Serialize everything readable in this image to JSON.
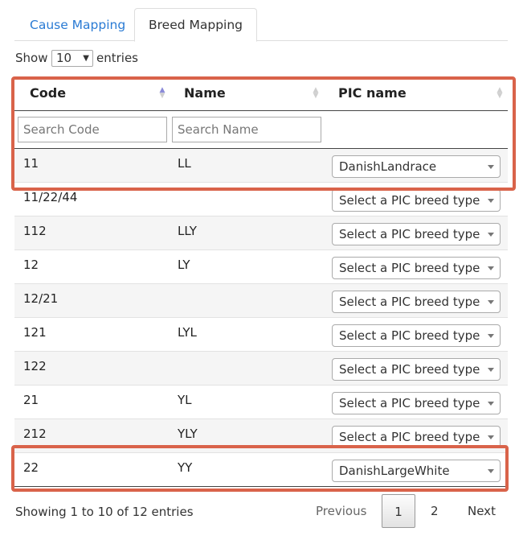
{
  "tabs": [
    {
      "label": "Cause Mapping",
      "active": false
    },
    {
      "label": "Breed Mapping",
      "active": true
    }
  ],
  "length": {
    "show_label": "Show",
    "value": "10",
    "entries_label": "entries"
  },
  "columns": [
    {
      "label": "Code",
      "sort": "asc"
    },
    {
      "label": "Name",
      "sort": "none"
    },
    {
      "label": "PIC name",
      "sort": "none"
    }
  ],
  "search": {
    "code_placeholder": "Search Code",
    "name_placeholder": "Search Name"
  },
  "rows": [
    {
      "code": "11",
      "name": "LL",
      "pic": "DanishLandrace"
    },
    {
      "code": "11/22/44",
      "name": "",
      "pic": "Select a PIC breed type"
    },
    {
      "code": "112",
      "name": "LLY",
      "pic": "Select a PIC breed type"
    },
    {
      "code": "12",
      "name": "LY",
      "pic": "Select a PIC breed type"
    },
    {
      "code": "12/21",
      "name": "",
      "pic": "Select a PIC breed type"
    },
    {
      "code": "121",
      "name": "LYL",
      "pic": "Select a PIC breed type"
    },
    {
      "code": "122",
      "name": "",
      "pic": "Select a PIC breed type"
    },
    {
      "code": "21",
      "name": "YL",
      "pic": "Select a PIC breed type"
    },
    {
      "code": "212",
      "name": "YLY",
      "pic": "Select a PIC breed type"
    },
    {
      "code": "22",
      "name": "YY",
      "pic": "DanishLargeWhite"
    }
  ],
  "info": "Showing 1 to 10 of 12 entries",
  "pagination": {
    "previous": "Previous",
    "pages": [
      "1",
      "2"
    ],
    "current": "1",
    "next": "Next"
  },
  "colors": {
    "link": "#2a7bd4",
    "highlight": "#d9634a",
    "sort_active": "#8a8ad8"
  }
}
